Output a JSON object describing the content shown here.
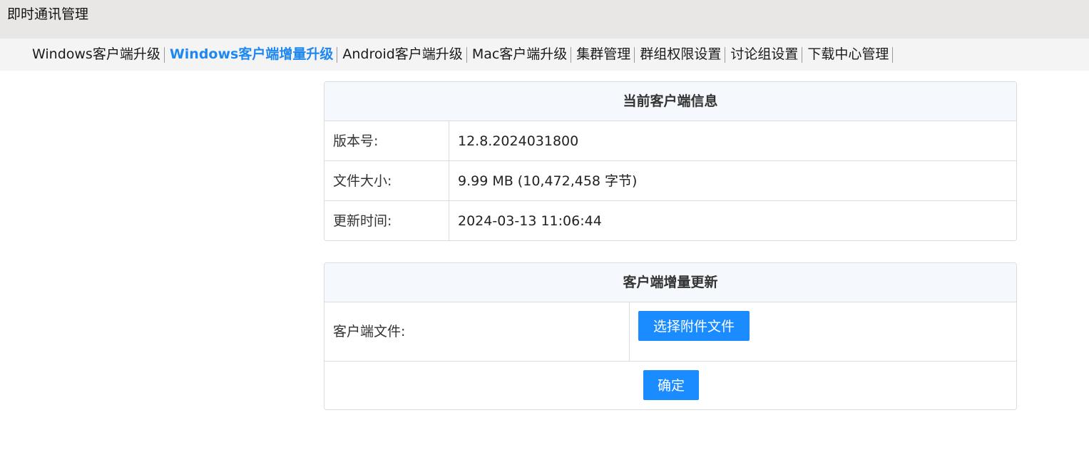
{
  "app": {
    "title": "即时通讯管理"
  },
  "nav": {
    "items": [
      {
        "label": "Windows客户端升级",
        "active": false
      },
      {
        "label": "Windows客户端增量升级",
        "active": true
      },
      {
        "label": "Android客户端升级",
        "active": false
      },
      {
        "label": "Mac客户端升级",
        "active": false
      },
      {
        "label": "集群管理",
        "active": false
      },
      {
        "label": "群组权限设置",
        "active": false
      },
      {
        "label": "讨论组设置",
        "active": false
      },
      {
        "label": "下载中心管理",
        "active": false
      }
    ]
  },
  "current_info": {
    "header": "当前客户端信息",
    "rows": [
      {
        "label": "版本号:",
        "value": "12.8.2024031800"
      },
      {
        "label": "文件大小:",
        "value": "9.99 MB (10,472,458 字节)"
      },
      {
        "label": "更新时间:",
        "value": "2024-03-13 11:06:44"
      }
    ]
  },
  "incremental_update": {
    "header": "客户端增量更新",
    "file_label": "客户端文件:",
    "choose_button": "选择附件文件",
    "confirm_button": "确定"
  },
  "colors": {
    "accent": "#1a8cff",
    "active_nav": "#1e88f0",
    "titlebar_bg": "#e8e7e5",
    "navbar_bg": "#f4f4f4",
    "panel_head_bg": "#f5f8fc"
  }
}
